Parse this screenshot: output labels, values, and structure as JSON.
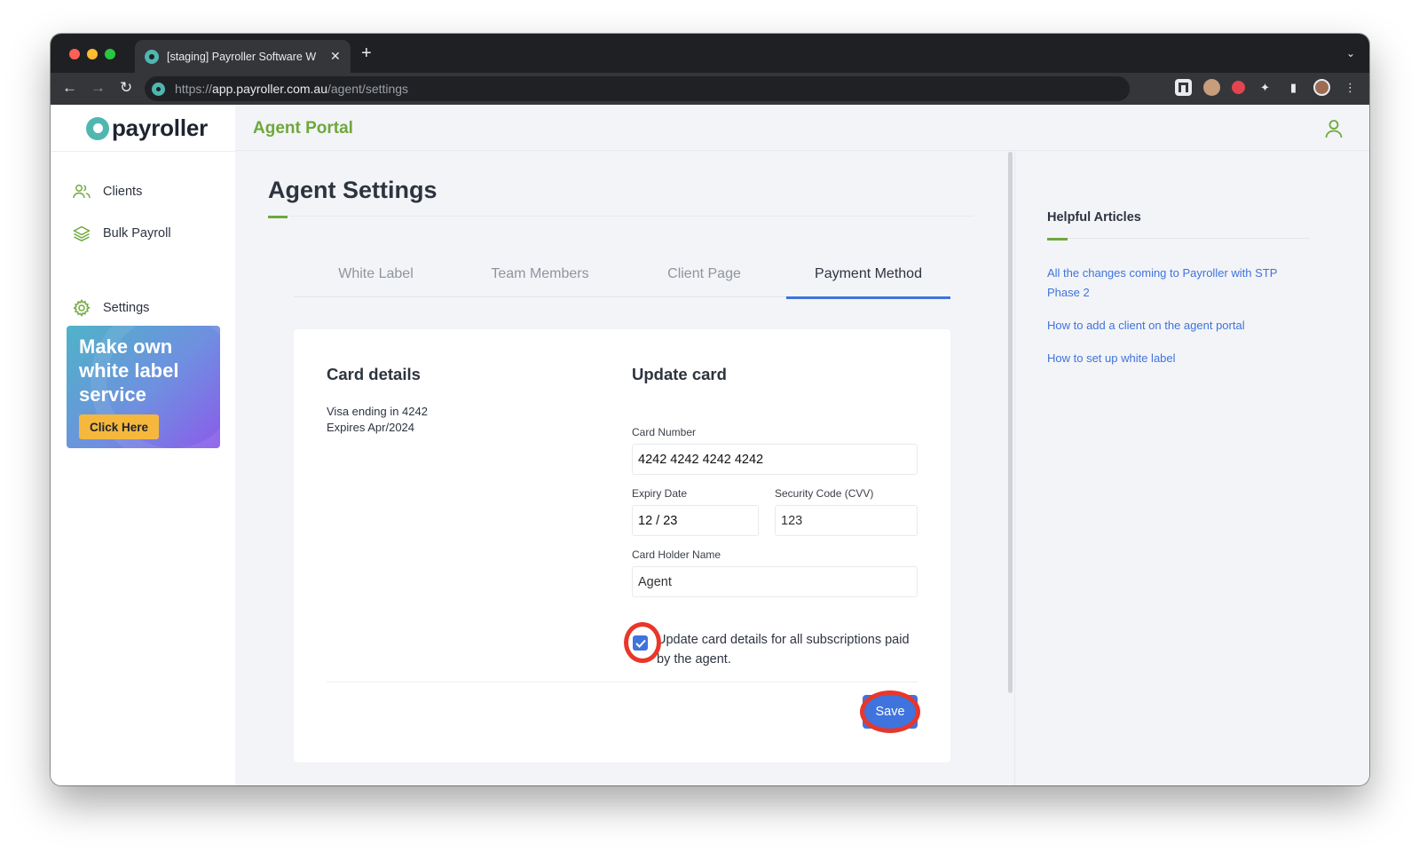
{
  "browser": {
    "tab_title": "[staging] Payroller Software W",
    "url_scheme": "https://",
    "url_host": "app.payroller.com.au",
    "url_path": "/agent/settings"
  },
  "sidebar": {
    "logo_text": "payroller",
    "items": [
      {
        "label": "Clients",
        "icon": "users-icon"
      },
      {
        "label": "Bulk Payroll",
        "icon": "layers-icon"
      },
      {
        "label": "Settings",
        "icon": "gear-icon"
      }
    ],
    "promo": {
      "text": "Make own white label service",
      "button": "Click Here"
    }
  },
  "topbar": {
    "portal_title": "Agent Portal"
  },
  "page": {
    "title": "Agent Settings",
    "tabs": [
      {
        "label": "White Label",
        "active": false
      },
      {
        "label": "Team Members",
        "active": false
      },
      {
        "label": "Client Page",
        "active": false
      },
      {
        "label": "Payment Method",
        "active": true
      }
    ]
  },
  "card_details": {
    "title": "Card details",
    "line1": "Visa ending in 4242",
    "line2": "Expires Apr/2024"
  },
  "update_card": {
    "title": "Update card",
    "card_number_label": "Card Number",
    "card_number_value": "4242 4242 4242 4242",
    "expiry_label": "Expiry Date",
    "expiry_value": "12 / 23",
    "cvv_label": "Security Code (CVV)",
    "cvv_value": "123",
    "holder_label": "Card Holder Name",
    "holder_value": "Agent",
    "checkbox_checked": true,
    "checkbox_label": "Update card details for all subscriptions paid by the agent.",
    "save_label": "Save"
  },
  "help": {
    "title": "Helpful Articles",
    "links": [
      "All the changes coming to Payroller with STP Phase 2",
      "How to add a client on the agent portal",
      "How to set up white label"
    ]
  },
  "colors": {
    "brand_green": "#6ea83c",
    "accent_blue": "#3f73de",
    "highlight_red": "#e8372a",
    "promo_button": "#f5b83d"
  }
}
